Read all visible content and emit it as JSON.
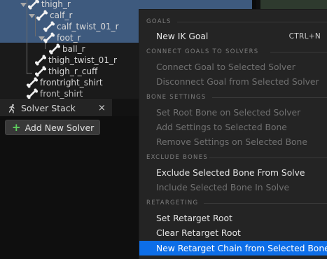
{
  "bone_tree": {
    "rows": [
      {
        "label": "thigh_r"
      },
      {
        "label": "calf_r"
      },
      {
        "label": "calf_twist_01_r"
      },
      {
        "label": "foot_r"
      },
      {
        "label": "ball_r"
      },
      {
        "label": "thigh_twist_01_r"
      },
      {
        "label": "thigh_r_cuff"
      },
      {
        "label": "frontright_shirt"
      },
      {
        "label": "front_shirt"
      }
    ]
  },
  "solver_stack": {
    "tab_title": "Solver Stack",
    "close_glyph": "×",
    "add_button_icon": "+",
    "add_button_label": "Add New Solver"
  },
  "context_menu": {
    "sections": {
      "goals": "GOALS",
      "connect": "CONNECT GOALS TO SOLVERS",
      "bone_settings": "BONE SETTINGS",
      "exclude": "EXCLUDE BONES",
      "retargeting": "RETARGETING"
    },
    "items": {
      "new_ik_goal": "New IK Goal",
      "new_ik_goal_shortcut": "CTRL+N",
      "connect_goal": "Connect Goal to Selected Solver",
      "disconnect_goal": "Disconnect Goal from Selected Solver",
      "set_root_bone": "Set Root Bone on Selected Solver",
      "add_settings": "Add Settings to Selected Bone",
      "remove_settings": "Remove Settings on Selected Bone",
      "exclude_bone": "Exclude Selected Bone From Solve",
      "include_bone": "Include Selected Bone In Solve",
      "set_retarget_root": "Set Retarget Root",
      "clear_retarget_root": "Clear Retarget Root",
      "new_retarget_chain": "New Retarget Chain from Selected Bones"
    }
  },
  "colors": {
    "selection": "#3e5a7e",
    "menu_highlight": "#0d6ee8",
    "add_icon": "#5fd05f"
  }
}
